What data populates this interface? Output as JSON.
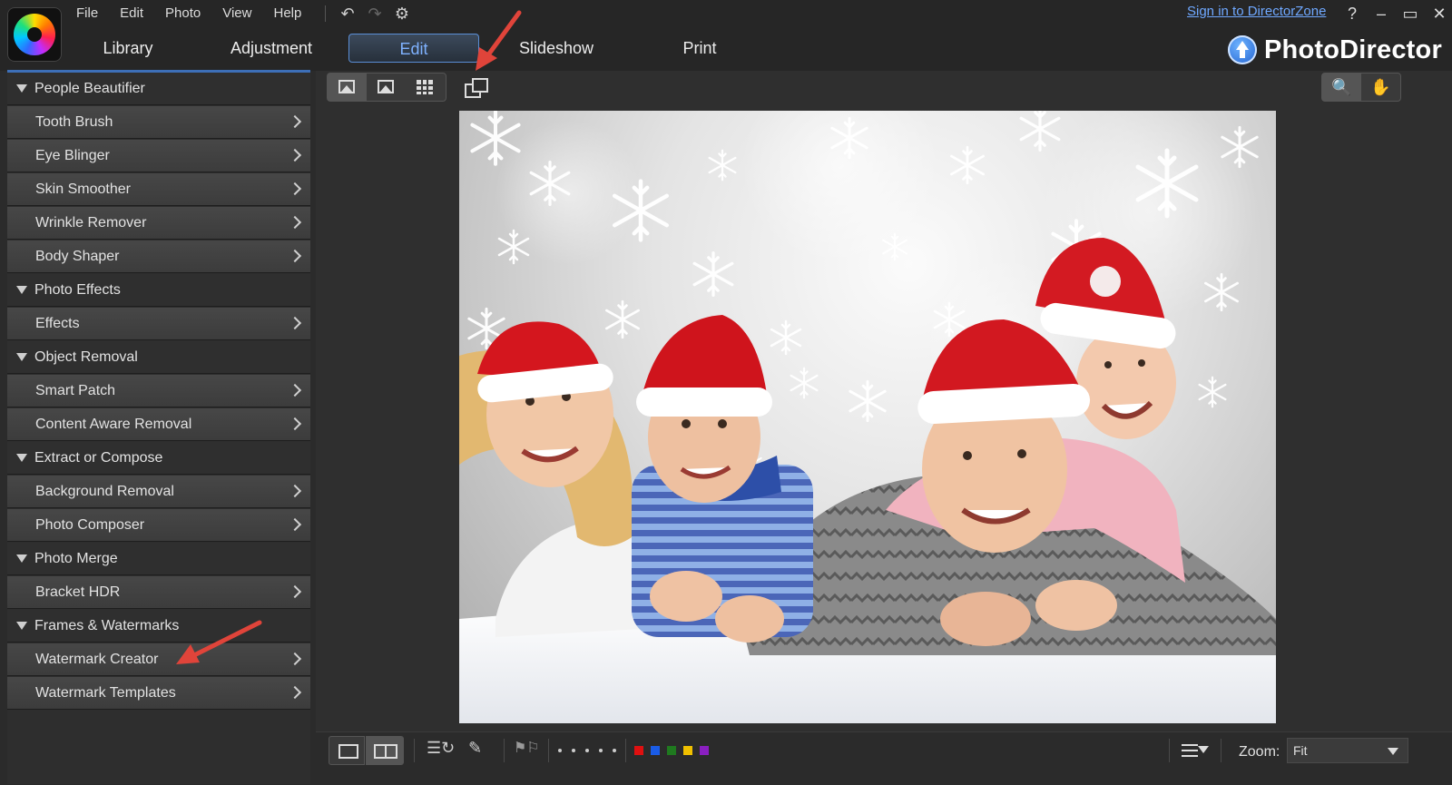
{
  "menu": [
    "File",
    "Edit",
    "Photo",
    "View",
    "Help"
  ],
  "quick_icons": [
    "undo-icon",
    "redo-icon",
    "settings-gear-icon"
  ],
  "tabs": [
    {
      "label": "Library"
    },
    {
      "label": "Adjustment"
    },
    {
      "label": "Edit",
      "active": true
    },
    {
      "label": "Slideshow"
    },
    {
      "label": "Print"
    }
  ],
  "signin_label": "Sign in to DirectorZone",
  "window_controls": [
    "?",
    "–",
    "▭",
    "✕"
  ],
  "brand": {
    "name": "PhotoDirector",
    "accent": "#3d6fb8"
  },
  "panel": [
    {
      "type": "header",
      "label": "People Beautifier"
    },
    {
      "type": "item",
      "label": "Tooth Brush"
    },
    {
      "type": "item",
      "label": "Eye Blinger"
    },
    {
      "type": "item",
      "label": "Skin Smoother"
    },
    {
      "type": "item",
      "label": "Wrinkle Remover"
    },
    {
      "type": "item",
      "label": "Body Shaper"
    },
    {
      "type": "header",
      "label": "Photo Effects"
    },
    {
      "type": "item",
      "label": "Effects"
    },
    {
      "type": "header",
      "label": "Object Removal"
    },
    {
      "type": "item",
      "label": "Smart Patch"
    },
    {
      "type": "item",
      "label": "Content Aware Removal"
    },
    {
      "type": "header",
      "label": "Extract or Compose"
    },
    {
      "type": "item",
      "label": "Background Removal"
    },
    {
      "type": "item",
      "label": "Photo Composer"
    },
    {
      "type": "header",
      "label": "Photo Merge"
    },
    {
      "type": "item",
      "label": "Bracket HDR"
    },
    {
      "type": "header",
      "label": "Frames & Watermarks"
    },
    {
      "type": "item",
      "label": "Watermark Creator"
    },
    {
      "type": "item",
      "label": "Watermark Templates"
    }
  ],
  "zoom": {
    "label": "Zoom:",
    "value": "Fit"
  },
  "color_labels": [
    "#e01010",
    "#1a5ce6",
    "#1f7a1f",
    "#f0c000",
    "#8a1fc0"
  ],
  "annotation_color": "#e0443a"
}
